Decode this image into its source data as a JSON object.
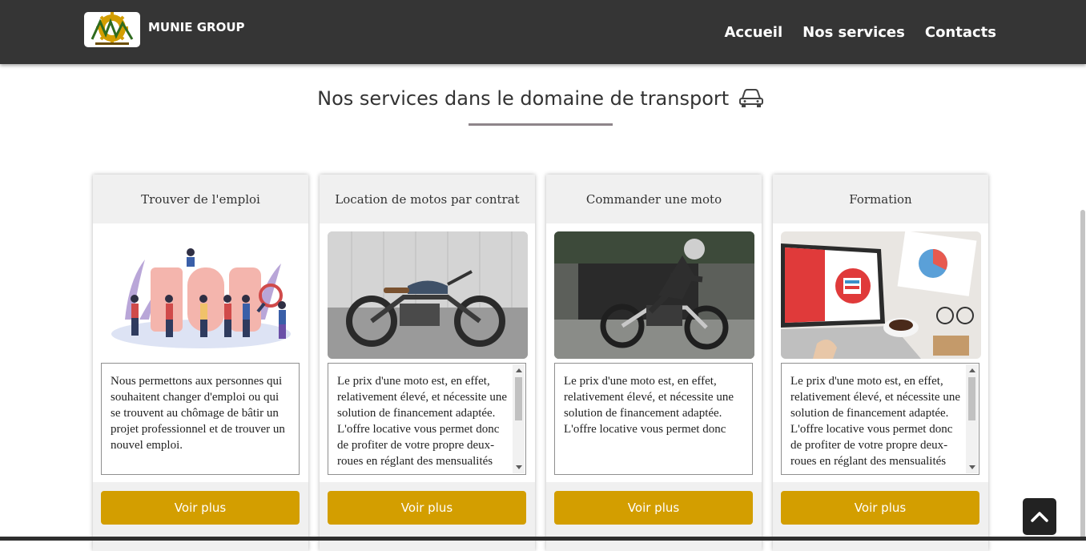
{
  "header": {
    "brand": "MUNIE GROUP",
    "logo_text": "MUNIE GROUP",
    "nav": [
      "Accueil",
      "Nos services",
      "Contacts"
    ]
  },
  "section": {
    "title": "Nos services dans le domaine de transport",
    "title_icon": "car-icon"
  },
  "cards": [
    {
      "title": "Trouver de l'emploi",
      "image": "job-illustration",
      "text": "Nous permettons aux personnes qui souhaitent changer d'emploi ou qui se trouvent au chômage de bâtir un projet professionnel et de trouver un nouvel emploi.",
      "button": "Voir plus"
    },
    {
      "title": "Location de motos par contrat",
      "image": "motorcycle-photo",
      "text": "Le prix d'une moto est, en effet, relativement élevé, et nécessite une solution de financement adaptée. L'offre locative vous permet donc de profiter de votre propre deux-roues en réglant des mensualités",
      "button": "Voir plus"
    },
    {
      "title": "Commander une moto",
      "image": "rider-photo",
      "text": "Le prix d'une moto est, en effet, relativement élevé, et nécessite une solution de financement adaptée. L'offre locative vous permet donc",
      "button": "Voir plus"
    },
    {
      "title": "Formation",
      "image": "elearning-laptop-photo",
      "text": "Le prix d'une moto est, en effet, relativement élevé, et nécessite une solution de financement adaptée. L'offre locative vous permet donc de profiter de votre propre deux-roues en réglant des mensualités",
      "button": "Voir plus"
    }
  ],
  "colors": {
    "navbar": "#353535",
    "accent": "#d39e00",
    "card_header": "#f0f0f0",
    "divider": "#8e858a"
  },
  "back_to_top_icon": "chevron-up-icon"
}
